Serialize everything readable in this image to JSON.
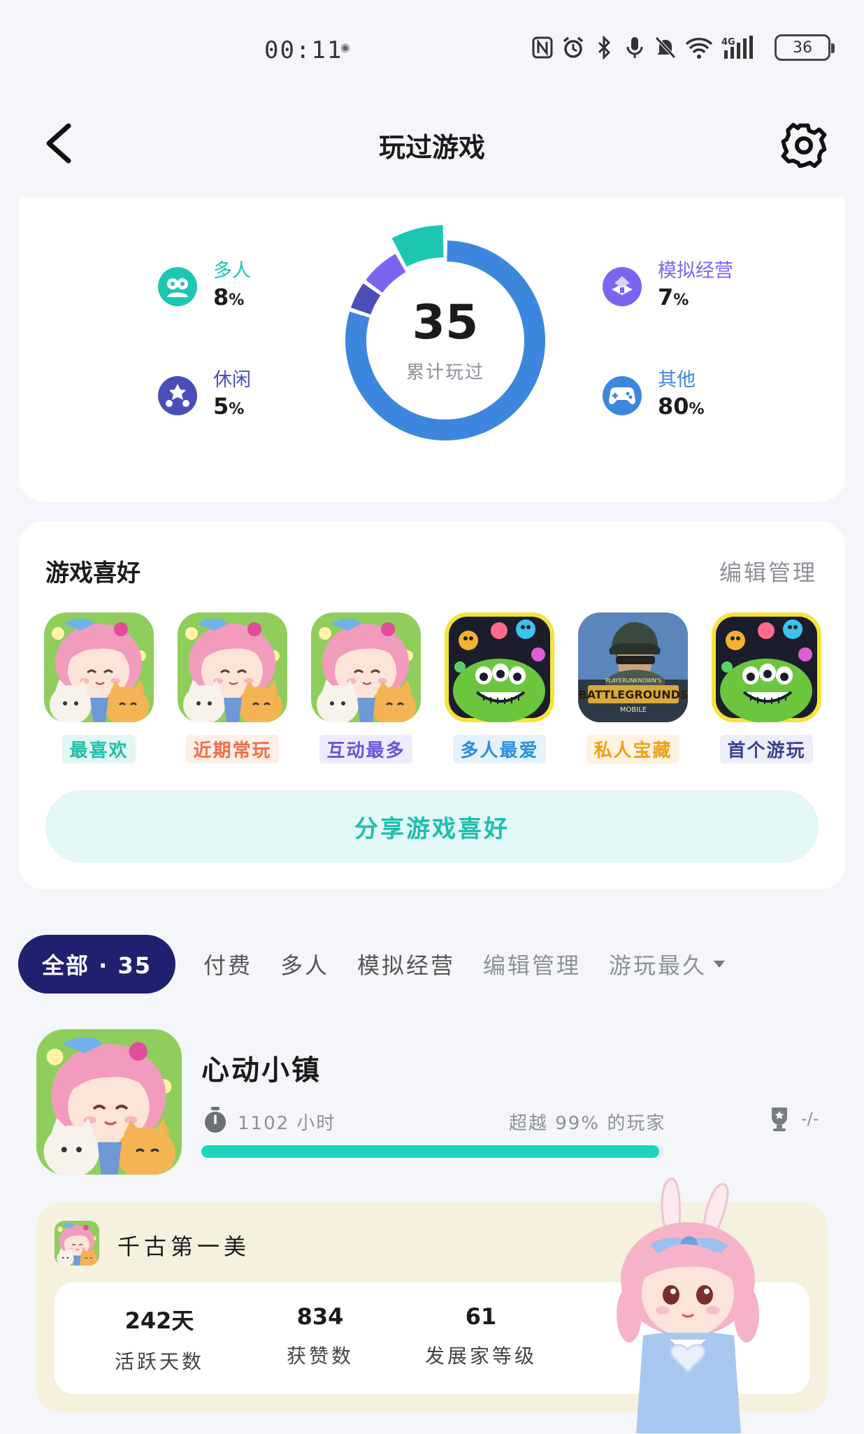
{
  "status_bar": {
    "time": "00:11",
    "battery": "36"
  },
  "header": {
    "title": "玩过游戏"
  },
  "stats": {
    "total": "35",
    "total_label": "累计玩过",
    "categories": [
      {
        "name": "多人",
        "pct": "8",
        "color": "#1cc7b1",
        "icon": "multiplayer-icon"
      },
      {
        "name": "休闲",
        "pct": "5",
        "color": "#4a4fb8",
        "icon": "casual-icon"
      },
      {
        "name": "模拟经营",
        "pct": "7",
        "color": "#7c64f1",
        "icon": "simulation-icon"
      },
      {
        "name": "其他",
        "pct": "80",
        "color": "#3d86dd",
        "icon": "gamepad-icon"
      }
    ],
    "pct_unit": "%"
  },
  "preferences": {
    "title": "游戏喜好",
    "edit_label": "编辑管理",
    "items": [
      {
        "tag": "最喜欢",
        "tag_color": "#1fbfa8",
        "tag_bg": "#e2f6f3",
        "game": "heart-town"
      },
      {
        "tag": "近期常玩",
        "tag_color": "#ef6f45",
        "tag_bg": "#fdeee7",
        "game": "heart-town"
      },
      {
        "tag": "互动最多",
        "tag_color": "#6a55d6",
        "tag_bg": "#efebfc",
        "game": "heart-town"
      },
      {
        "tag": "多人最爱",
        "tag_color": "#2a8fd8",
        "tag_bg": "#e5f2fc",
        "game": "green-monster"
      },
      {
        "tag": "私人宝藏",
        "tag_color": "#eda019",
        "tag_bg": "#fdf3e0",
        "game": "battlegrounds"
      },
      {
        "tag": "首个游玩",
        "tag_color": "#3b4090",
        "tag_bg": "#eceef8",
        "game": "green-monster"
      }
    ],
    "share_label": "分享游戏喜好"
  },
  "tabs": {
    "active": "全部 · 35",
    "items": [
      "付费",
      "多人",
      "模拟经营",
      "编辑管理"
    ],
    "sort_label": "游玩最久"
  },
  "game": {
    "name": "心动小镇",
    "hours": "1102 小时",
    "rank": "超越 99% 的玩家",
    "trophy": "-/-",
    "progress_fraction": 0.99
  },
  "character": {
    "name": "千古第一美",
    "stats": [
      {
        "value": "242天",
        "label": "活跃天数"
      },
      {
        "value": "834",
        "label": "获赞数"
      },
      {
        "value": "61",
        "label": "发展家等级"
      }
    ]
  }
}
